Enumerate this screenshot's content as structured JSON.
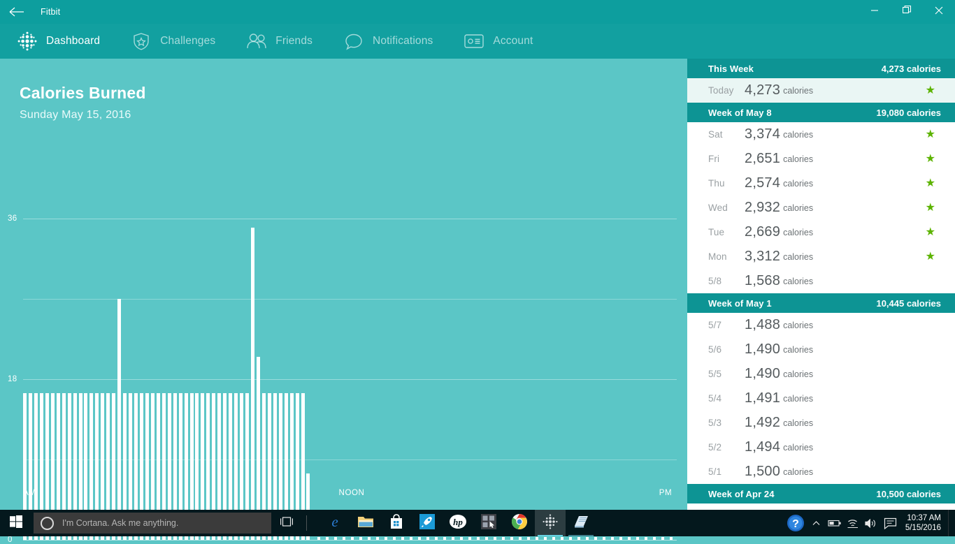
{
  "window": {
    "title": "Fitbit",
    "back_icon": "back-arrow-icon",
    "minimize_label": "Minimize",
    "restore_label": "Restore",
    "close_label": "Close"
  },
  "nav": {
    "items": [
      {
        "label": "Dashboard",
        "icon": "fitbit-dots-icon",
        "active": true
      },
      {
        "label": "Challenges",
        "icon": "shield-star-icon",
        "active": false
      },
      {
        "label": "Friends",
        "icon": "people-icon",
        "active": false
      },
      {
        "label": "Notifications",
        "icon": "speech-bubble-icon",
        "active": false
      },
      {
        "label": "Account",
        "icon": "id-card-icon",
        "active": false
      }
    ]
  },
  "chart_panel": {
    "title": "Calories Burned",
    "subtitle": "Sunday May 15, 2016"
  },
  "chart_data": {
    "type": "bar",
    "title": "Calories Burned",
    "subtitle": "Sunday May 15, 2016",
    "xlabel": "",
    "ylabel": "",
    "ylim": [
      0,
      40
    ],
    "yticks": [
      0,
      18,
      36
    ],
    "ytick_labels": [
      "0",
      "18",
      "36"
    ],
    "gridlines": [
      0,
      9,
      18,
      27,
      36
    ],
    "grid": true,
    "legend": null,
    "x_axis_labels": [
      {
        "text": "AM",
        "position": "left"
      },
      {
        "text": "NOON",
        "position": "center"
      },
      {
        "text": "PM",
        "position": "right"
      }
    ],
    "bar_color": "#ffffff",
    "plot_background": "#5bc6c6",
    "note": "Per-5-minute calories burned from midnight; bars stop at about 12:10 PM (current time), remaining intervals shown as baseline dots.",
    "values": [
      16.4,
      16.4,
      16.4,
      16.4,
      16.4,
      16.4,
      16.4,
      16.4,
      16.4,
      16.4,
      16.4,
      16.4,
      16.4,
      16.4,
      16.4,
      16.4,
      16.4,
      27.0,
      16.4,
      16.4,
      16.4,
      16.4,
      16.4,
      16.4,
      16.4,
      16.4,
      16.4,
      16.4,
      16.4,
      16.4,
      16.4,
      16.4,
      16.4,
      16.4,
      16.4,
      16.4,
      16.4,
      16.4,
      16.4,
      16.4,
      16.4,
      35.0,
      20.5,
      16.4,
      16.4,
      16.4,
      16.4,
      16.4,
      16.4,
      16.4,
      16.4,
      7.4
    ],
    "empty_slot_count": 44,
    "max_value": 35,
    "baseline_value": 16.4
  },
  "sidebar": {
    "sections": [
      {
        "header": {
          "label": "This Week",
          "total": "4,273 calories"
        },
        "rows": [
          {
            "day": "Today",
            "value": "4,273",
            "unit": "calories",
            "star": true,
            "highlight": true
          }
        ]
      },
      {
        "header": {
          "label": "Week of May 8",
          "total": "19,080 calories"
        },
        "rows": [
          {
            "day": "Sat",
            "value": "3,374",
            "unit": "calories",
            "star": true,
            "highlight": false
          },
          {
            "day": "Fri",
            "value": "2,651",
            "unit": "calories",
            "star": true,
            "highlight": false
          },
          {
            "day": "Thu",
            "value": "2,574",
            "unit": "calories",
            "star": true,
            "highlight": false
          },
          {
            "day": "Wed",
            "value": "2,932",
            "unit": "calories",
            "star": true,
            "highlight": false
          },
          {
            "day": "Tue",
            "value": "2,669",
            "unit": "calories",
            "star": true,
            "highlight": false
          },
          {
            "day": "Mon",
            "value": "3,312",
            "unit": "calories",
            "star": true,
            "highlight": false
          },
          {
            "day": "5/8",
            "value": "1,568",
            "unit": "calories",
            "star": false,
            "highlight": false
          }
        ]
      },
      {
        "header": {
          "label": "Week of May 1",
          "total": "10,445 calories"
        },
        "rows": [
          {
            "day": "5/7",
            "value": "1,488",
            "unit": "calories",
            "star": false,
            "highlight": false
          },
          {
            "day": "5/6",
            "value": "1,490",
            "unit": "calories",
            "star": false,
            "highlight": false
          },
          {
            "day": "5/5",
            "value": "1,490",
            "unit": "calories",
            "star": false,
            "highlight": false
          },
          {
            "day": "5/4",
            "value": "1,491",
            "unit": "calories",
            "star": false,
            "highlight": false
          },
          {
            "day": "5/3",
            "value": "1,492",
            "unit": "calories",
            "star": false,
            "highlight": false
          },
          {
            "day": "5/2",
            "value": "1,494",
            "unit": "calories",
            "star": false,
            "highlight": false
          },
          {
            "day": "5/1",
            "value": "1,500",
            "unit": "calories",
            "star": false,
            "highlight": false
          }
        ]
      },
      {
        "header": {
          "label": "Week of Apr 24",
          "total": "10,500 calories"
        },
        "rows": []
      }
    ],
    "star_color": "#5cb300",
    "star_glyph": "★"
  },
  "taskbar": {
    "start_label": "Start",
    "cortana_placeholder": "I'm Cortana. Ask me anything.",
    "task_view_label": "Task View",
    "apps": [
      {
        "name": "microsoft-edge",
        "state": "closed"
      },
      {
        "name": "file-explorer",
        "state": "closed"
      },
      {
        "name": "microsoft-store",
        "state": "closed"
      },
      {
        "name": "rocket-app",
        "state": "closed"
      },
      {
        "name": "hp-app",
        "state": "closed"
      },
      {
        "name": "touch-app",
        "state": "closed"
      },
      {
        "name": "google-chrome",
        "state": "closed"
      },
      {
        "name": "fitbit",
        "state": "active"
      },
      {
        "name": "notepad-app",
        "state": "open"
      }
    ],
    "tray": [
      {
        "name": "help-icon"
      },
      {
        "name": "show-hidden-icons-chevron"
      },
      {
        "name": "battery-icon"
      },
      {
        "name": "wifi-icon"
      },
      {
        "name": "volume-icon"
      },
      {
        "name": "action-center-icon"
      }
    ],
    "clock": {
      "time": "10:37 AM",
      "date": "5/15/2016"
    }
  },
  "colors": {
    "nav_teal": "#12a0a0",
    "title_teal": "#0d9e9e",
    "chart_teal": "#5bc6c6",
    "section_header_teal": "#0d9494",
    "today_highlight": "#eaf6f4",
    "star_green": "#5cb300",
    "taskbar": "#04181d"
  }
}
